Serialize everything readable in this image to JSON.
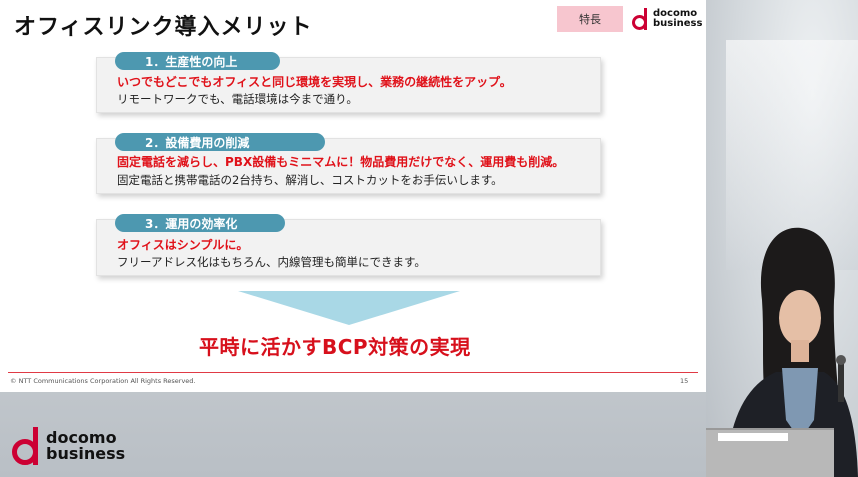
{
  "slide": {
    "title": "オフィスリンク導入メリット",
    "badge": "特長",
    "logo": {
      "line1": "docomo",
      "line2": "business"
    },
    "cards": [
      {
        "heading": "1．生産性の向上",
        "highlight": "いつでもどこでもオフィスと同じ環境を実現し、業務の継続性をアップ。",
        "detail": "リモートワークでも、電話環境は今まで通り。"
      },
      {
        "heading": "2．設備費用の削減",
        "highlight": "固定電話を減らし、PBX設備もミニマムに！物品費用だけでなく、運用費も削減。",
        "detail": "固定電話と携帯電話の2台持ち、解消し、コストカットをお手伝いします。"
      },
      {
        "heading": "3．運用の効率化",
        "highlight": "オフィスはシンプルに。",
        "detail": "フリーアドレス化はもちろん、内線管理も簡単にできます。"
      }
    ],
    "conclusion": "平時に活かすBCP対策の実現",
    "copyright": "© NTT Communications Corporation All Rights Reserved.",
    "page_number": "15"
  },
  "stage_logo": {
    "line1": "docomo",
    "line2": "business"
  },
  "colors": {
    "brand_red": "#cc0033",
    "pill_blue": "#4d98b0",
    "highlight_red": "#e0121a"
  }
}
